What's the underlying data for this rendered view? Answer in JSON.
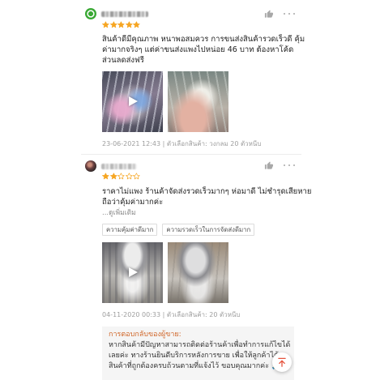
{
  "colors": {
    "star": "#f6a623",
    "accent": "#e5533d",
    "reply_title": "#d0672a",
    "icon_gray": "#a8a8a8"
  },
  "icons": {
    "like": "thumbs-up-icon",
    "more": "more-dots-icon",
    "play": "play-icon",
    "scroll_top": "arrow-up-icon"
  },
  "reviews": [
    {
      "rating": 5,
      "max_rating": 5,
      "text_lines": [
        "สินค้าดีมีคุณภาพ หนาพอสมควร การขนส่งสินค้ารวดเร็วดี คุ้ม",
        "ค่ามากจริงๆ แต่ค่าขนส่งแพงไปหน่อย 46 บาท ต้องหาโค้ด",
        "ส่วนลดส่งฟรี"
      ],
      "media": [
        {
          "play": true
        },
        {
          "play": false
        }
      ],
      "meta": "23-06-2021 12:43 | ตัวเลือกสินค้า: วงกลม 20 ตัวหนีบ"
    },
    {
      "rating": 2,
      "max_rating": 5,
      "text_lines": [
        "ราคาไม่แพง ร้านค้าจัดส่งรวดเร็วมากๆ ห่อมาดี ไม่ชำรุดเสียหาย",
        "ถือว่าคุ้มค่ามากค่ะ"
      ],
      "see_more": "...ดูเพิ่มเติม",
      "tags": [
        "ความคุ้มค่าดีมาก",
        "ความรวดเร็วในการจัดส่งดีมาก"
      ],
      "media": [
        {
          "play": true
        },
        {
          "play": false
        }
      ],
      "meta": "04-11-2020 00:33 | ตัวเลือกสินค้า: 20 ตัวหนีบ",
      "seller_reply": {
        "title": "การตอบกลับของผู้ขาย:",
        "lines": [
          "หากสินค้ามีปัญหาสามารถติดต่อร้านค้าเพื่อทำการแก้ไขได้",
          "เลยค่ะ ทางร้านยินดีบริการหลังการขาย เพื่อให้ลูกค้าได้",
          "สินค้าที่ถูกต้องครบถ้วนตามที่แจ้งไว้ ขอบคุณมากค่ะ 🙏"
        ]
      }
    }
  ]
}
